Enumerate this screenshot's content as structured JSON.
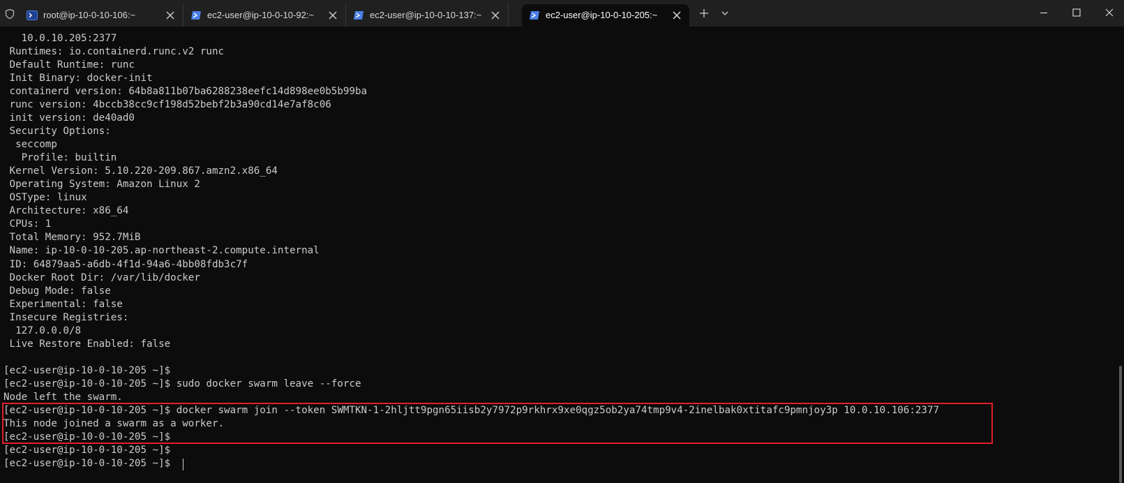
{
  "tabs": [
    {
      "label": "root@ip-10-0-10-106:~",
      "icon": "shell-icon",
      "active": false
    },
    {
      "label": "ec2-user@ip-10-0-10-92:~",
      "icon": "powershell-icon",
      "active": false
    },
    {
      "label": "ec2-user@ip-10-0-10-137:~",
      "icon": "powershell-icon",
      "active": false
    },
    {
      "label": "ec2-user@ip-10-0-10-205:~",
      "icon": "powershell-icon",
      "active": true
    }
  ],
  "tabbar_icons": {
    "new_tab": "plus-icon",
    "dropdown": "chevron-down-icon",
    "minimize": "minimize-icon",
    "maximize": "maximize-icon",
    "close": "close-icon",
    "shield": "shield-icon"
  },
  "colors": {
    "terminal_bg": "#0c0c0c",
    "terminal_fg": "#cccccc",
    "tabbar_bg": "#202020",
    "highlight": "#e0202a",
    "tab_icon_accent": "#4a7fe6"
  },
  "terminal": {
    "lines": [
      "   10.0.10.205:2377",
      " Runtimes: io.containerd.runc.v2 runc",
      " Default Runtime: runc",
      " Init Binary: docker-init",
      " containerd version: 64b8a811b07ba6288238eefc14d898ee0b5b99ba",
      " runc version: 4bccb38cc9cf198d52bebf2b3a90cd14e7af8c06",
      " init version: de40ad0",
      " Security Options:",
      "  seccomp",
      "   Profile: builtin",
      " Kernel Version: 5.10.220-209.867.amzn2.x86_64",
      " Operating System: Amazon Linux 2",
      " OSType: linux",
      " Architecture: x86_64",
      " CPUs: 1",
      " Total Memory: 952.7MiB",
      " Name: ip-10-0-10-205.ap-northeast-2.compute.internal",
      " ID: 64879aa5-a6db-4f1d-94a6-4bb08fdb3c7f",
      " Docker Root Dir: /var/lib/docker",
      " Debug Mode: false",
      " Experimental: false",
      " Insecure Registries:",
      "  127.0.0.0/8",
      " Live Restore Enabled: false",
      "",
      "[ec2-user@ip-10-0-10-205 ~]$",
      "[ec2-user@ip-10-0-10-205 ~]$ sudo docker swarm leave --force",
      "Node left the swarm.",
      "[ec2-user@ip-10-0-10-205 ~]$ docker swarm join --token SWMTKN-1-2hljtt9pgn65iisb2y7972p9rkhrx9xe0qgz5ob2ya74tmp9v4-2inelbak0xtitafc9pmnjoy3p 10.0.10.106:2377",
      "This node joined a swarm as a worker.",
      "[ec2-user@ip-10-0-10-205 ~]$",
      "[ec2-user@ip-10-0-10-205 ~]$",
      "[ec2-user@ip-10-0-10-205 ~]$ "
    ]
  }
}
